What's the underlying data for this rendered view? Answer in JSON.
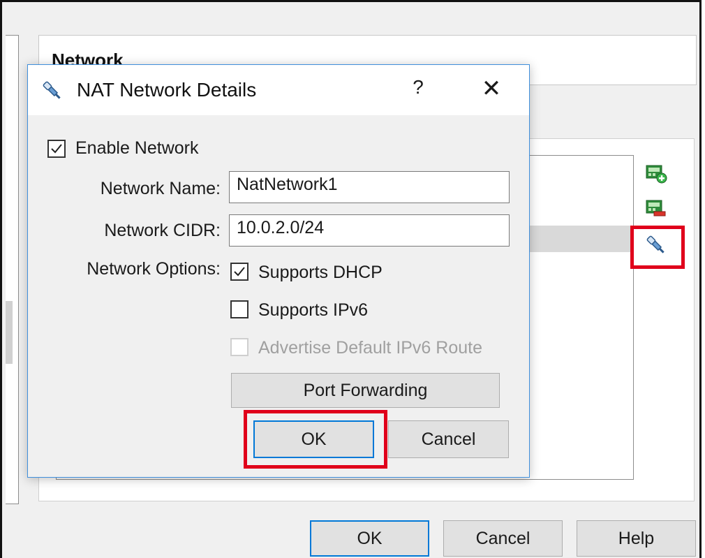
{
  "parent": {
    "section_title": "Network",
    "buttons": {
      "ok": "OK",
      "cancel": "Cancel",
      "help": "Help"
    },
    "tool_icons": [
      "add-network-icon",
      "remove-network-icon",
      "edit-network-icon"
    ]
  },
  "dialog": {
    "title": "NAT Network Details",
    "title_icon": "network-cable-icon",
    "help_glyph": "?",
    "close_glyph": "✕",
    "enable_network": {
      "label": "Enable Network",
      "checked": true
    },
    "network_name": {
      "label": "Network Name:",
      "value": "NatNetwork1"
    },
    "network_cidr": {
      "label": "Network CIDR:",
      "value": "10.0.2.0/24"
    },
    "network_options": {
      "label": "Network Options:",
      "supports_dhcp": {
        "label": "Supports DHCP",
        "checked": true
      },
      "supports_ipv6": {
        "label": "Supports IPv6",
        "checked": false
      },
      "advertise_default_ipv6_route": {
        "label": "Advertise Default IPv6 Route",
        "checked": false,
        "disabled": true
      }
    },
    "port_forwarding_label": "Port Forwarding",
    "ok_label": "OK",
    "cancel_label": "Cancel"
  },
  "colors": {
    "highlight": "#e0001b",
    "focus_border": "#0078d7",
    "dialog_border": "#3f8fdc"
  }
}
